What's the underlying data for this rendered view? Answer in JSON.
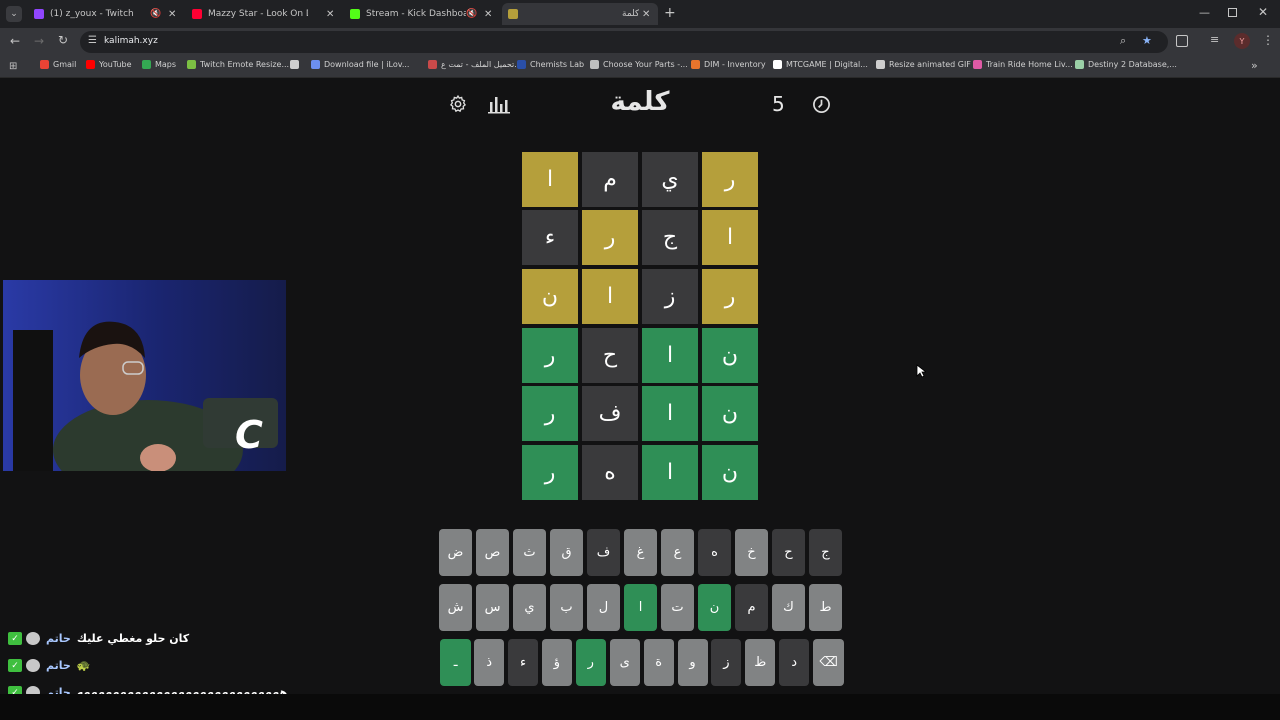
{
  "browser": {
    "tabs": [
      {
        "label": "(1) z_youx - Twitch",
        "color": "#9146ff",
        "muted": true
      },
      {
        "label": "Mazzy Star - Look On Down Fro",
        "color": "#ff0033",
        "muted": false
      },
      {
        "label": "Stream - Kick Dashboard",
        "color": "#53fc18",
        "muted": true
      },
      {
        "label": "كلمة",
        "color": "#b59f3b",
        "muted": false
      }
    ],
    "url": "kalimah.xyz",
    "profile_initial": "Y",
    "bookmarks": [
      {
        "label": "Gmail",
        "color": "#ea4335"
      },
      {
        "label": "YouTube",
        "color": "#ff0000"
      },
      {
        "label": "Maps",
        "color": "#34a853"
      },
      {
        "label": "Twitch Emote Resize...",
        "color": "#7cc043"
      },
      {
        "label": "",
        "color": "#cfcfcf"
      },
      {
        "label": "Download file | iLov...",
        "color": "#6c8ff0"
      },
      {
        "label": "تحميل الملف - تمت ع...",
        "color": "#c94a4a"
      },
      {
        "label": "Chemists Lab",
        "color": "#2a4fa8"
      },
      {
        "label": "Choose Your Parts -...",
        "color": "#bfbfbf"
      },
      {
        "label": "DIM - Inventory",
        "color": "#e8742c"
      },
      {
        "label": "MTCGAME | Digital...",
        "color": "#ffffff"
      },
      {
        "label": "Resize animated GIF",
        "color": "#cfcfcf"
      },
      {
        "label": "Train Ride Home Liv...",
        "color": "#e05aa6"
      },
      {
        "label": "Destiny 2 Database,...",
        "color": "#9bd0a7"
      }
    ]
  },
  "game": {
    "title": "كلمة",
    "streak": "5",
    "icons": {
      "settings": "gear-icon",
      "stats": "bar-chart-icon",
      "timer": "clock-icon"
    },
    "colors": {
      "correct": "#2f8f56",
      "present": "#b59f3b",
      "absent": "#3a3a3c",
      "key_default": "#818384"
    },
    "board": [
      [
        {
          "l": "ر",
          "s": "present"
        },
        {
          "l": "ي",
          "s": "absent"
        },
        {
          "l": "م",
          "s": "absent"
        },
        {
          "l": "ا",
          "s": "present"
        }
      ],
      [
        {
          "l": "ا",
          "s": "present"
        },
        {
          "l": "ج",
          "s": "absent"
        },
        {
          "l": "ر",
          "s": "present"
        },
        {
          "l": "ء",
          "s": "absent"
        }
      ],
      [
        {
          "l": "ر",
          "s": "present"
        },
        {
          "l": "ز",
          "s": "absent"
        },
        {
          "l": "ا",
          "s": "present"
        },
        {
          "l": "ن",
          "s": "present"
        }
      ],
      [
        {
          "l": "ن",
          "s": "correct"
        },
        {
          "l": "ا",
          "s": "correct"
        },
        {
          "l": "ح",
          "s": "absent"
        },
        {
          "l": "ر",
          "s": "correct"
        }
      ],
      [
        {
          "l": "ن",
          "s": "correct"
        },
        {
          "l": "ا",
          "s": "correct"
        },
        {
          "l": "ف",
          "s": "absent"
        },
        {
          "l": "ر",
          "s": "correct"
        }
      ],
      [
        {
          "l": "ن",
          "s": "correct"
        },
        {
          "l": "ا",
          "s": "correct"
        },
        {
          "l": "ه",
          "s": "absent"
        },
        {
          "l": "ر",
          "s": "correct"
        }
      ]
    ],
    "keyboard": [
      [
        {
          "k": "ج",
          "s": "absent"
        },
        {
          "k": "ح",
          "s": "absent"
        },
        {
          "k": "خ",
          "s": "default"
        },
        {
          "k": "ه",
          "s": "absent"
        },
        {
          "k": "ع",
          "s": "default"
        },
        {
          "k": "غ",
          "s": "default"
        },
        {
          "k": "ف",
          "s": "absent"
        },
        {
          "k": "ق",
          "s": "default"
        },
        {
          "k": "ث",
          "s": "default"
        },
        {
          "k": "ص",
          "s": "default"
        },
        {
          "k": "ض",
          "s": "default"
        }
      ],
      [
        {
          "k": "ط",
          "s": "default"
        },
        {
          "k": "ك",
          "s": "default"
        },
        {
          "k": "م",
          "s": "absent"
        },
        {
          "k": "ن",
          "s": "correct"
        },
        {
          "k": "ت",
          "s": "default"
        },
        {
          "k": "ا",
          "s": "correct"
        },
        {
          "k": "ل",
          "s": "default"
        },
        {
          "k": "ب",
          "s": "default"
        },
        {
          "k": "ي",
          "s": "default"
        },
        {
          "k": "س",
          "s": "default"
        },
        {
          "k": "ش",
          "s": "default"
        }
      ],
      [
        {
          "k": "⌫",
          "s": "default"
        },
        {
          "k": "د",
          "s": "absent"
        },
        {
          "k": "ظ",
          "s": "default"
        },
        {
          "k": "ز",
          "s": "absent"
        },
        {
          "k": "و",
          "s": "default"
        },
        {
          "k": "ة",
          "s": "default"
        },
        {
          "k": "ى",
          "s": "default"
        },
        {
          "k": "ر",
          "s": "correct"
        },
        {
          "k": "ؤ",
          "s": "default"
        },
        {
          "k": "ء",
          "s": "absent"
        },
        {
          "k": "ذ",
          "s": "default"
        },
        {
          "k": "ـ",
          "s": "correct"
        }
      ]
    ]
  },
  "chat": [
    {
      "user": "حاتم",
      "message": "كان حلو مغطي عليك"
    },
    {
      "user": "حاتم",
      "message": "🐢"
    },
    {
      "user": "حاتم",
      "message": "ههههههههههههههههههههههههههههه"
    }
  ]
}
